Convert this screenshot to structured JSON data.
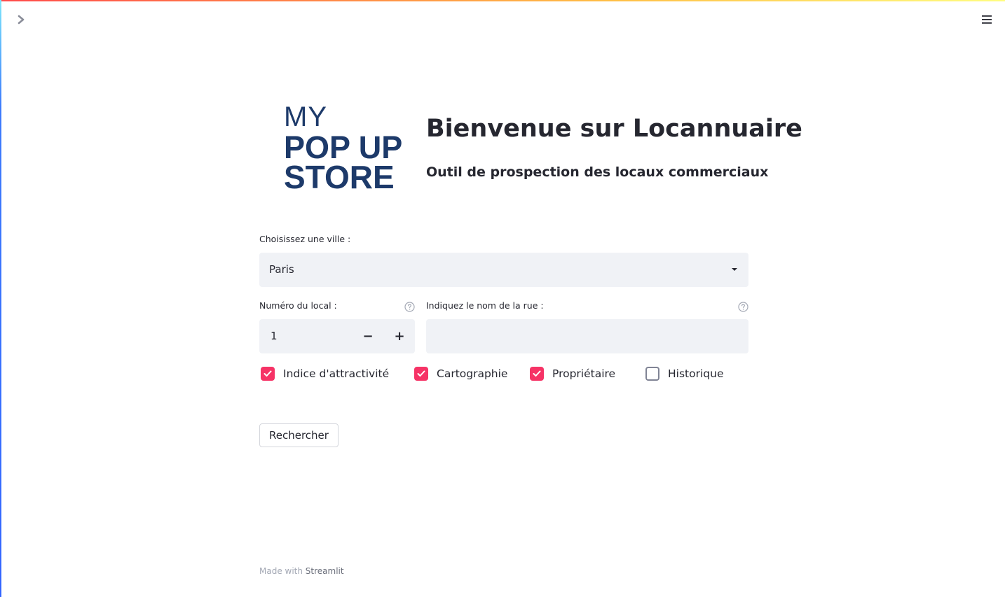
{
  "app": {
    "colors": {
      "accent": "#f63366",
      "input_bg": "#f0f2f6",
      "text": "#262730",
      "logo_blue": "#1d3a6a"
    }
  },
  "chrome": {
    "sidebar_toggle_icon": "chevron-right-icon",
    "menu_icon": "hamburger-menu-icon"
  },
  "header": {
    "logo_lines": [
      "MY",
      "POP UP",
      "STORE"
    ],
    "title": "Bienvenue sur Locannuaire",
    "subtitle": "Outil de prospection des locaux commerciaux"
  },
  "form": {
    "city": {
      "label": "Choisissez une ville :",
      "value": "Paris"
    },
    "number": {
      "label": "Numéro du local :",
      "value": "1",
      "minus_label": "−",
      "plus_label": "+"
    },
    "street": {
      "label": "Indiquez le nom de la rue :",
      "value": ""
    },
    "options": [
      {
        "label": "Indice d'attractivité",
        "checked": true
      },
      {
        "label": "Cartographie",
        "checked": true
      },
      {
        "label": "Propriétaire",
        "checked": true
      },
      {
        "label": "Historique",
        "checked": false
      }
    ],
    "submit_label": "Rechercher"
  },
  "footer": {
    "prefix": "Made with ",
    "link": "Streamlit"
  }
}
